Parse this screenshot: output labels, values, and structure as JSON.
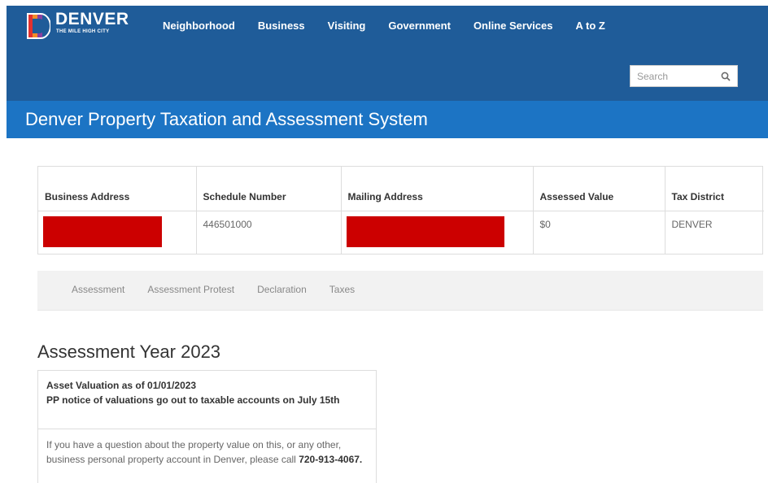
{
  "header": {
    "logo": {
      "name": "DENVER",
      "tagline": "THE MILE HIGH CITY"
    },
    "nav": [
      {
        "label": "Neighborhood"
      },
      {
        "label": "Business"
      },
      {
        "label": "Visiting"
      },
      {
        "label": "Government"
      },
      {
        "label": "Online Services"
      },
      {
        "label": "A to Z"
      }
    ],
    "search": {
      "placeholder": "Search",
      "icon": "search-icon"
    }
  },
  "title_band": {
    "title": "Denver Property Taxation and Assessment System"
  },
  "property_table": {
    "headers": [
      "Business Address",
      "Schedule Number",
      "Mailing Address",
      "Assessed Value",
      "Tax District"
    ],
    "row": {
      "schedule_number": "446501000",
      "assessed_value": "$0",
      "tax_district": "DENVER"
    }
  },
  "tabs": [
    {
      "label": "Assessment"
    },
    {
      "label": "Assessment Protest"
    },
    {
      "label": "Declaration"
    },
    {
      "label": "Taxes"
    }
  ],
  "assessment": {
    "heading": "Assessment Year 2023",
    "panel_title_line1": "Asset Valuation as of 01/01/2023",
    "panel_title_line2": "PP notice of valuations go out to taxable accounts on July 15th",
    "body_text": "If you have a question about the property value on this, or any other, business personal property account in Denver, please call",
    "phone": "720-913-4067."
  },
  "colors": {
    "header_bg": "#1f5c99",
    "title_bg": "#1c74c4",
    "redaction": "#cc0000"
  }
}
